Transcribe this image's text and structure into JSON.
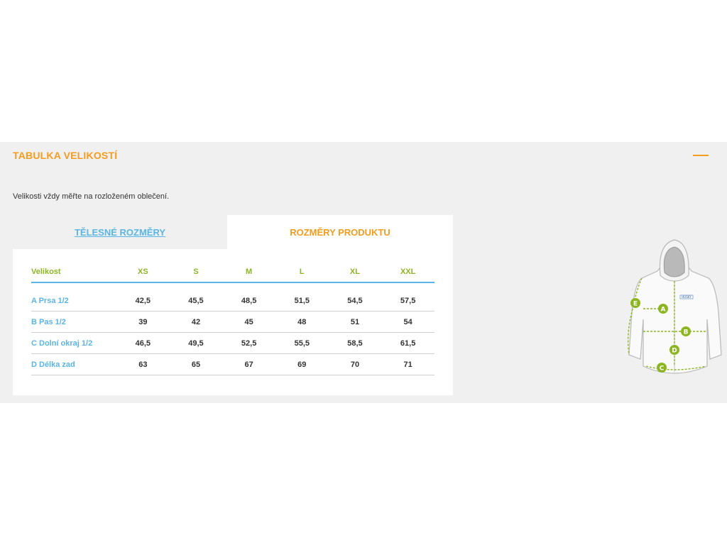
{
  "section": {
    "title": "TABULKA VELIKOSTÍ",
    "note": "Velikosti vždy měřte na rozloženém oblečení."
  },
  "tabs": [
    {
      "label": "TĚLESNÉ ROZMĚRY",
      "active": false
    },
    {
      "label": "ROZMĚRY PRODUKTU",
      "active": true
    }
  ],
  "table": {
    "headers": [
      "Velikost",
      "XS",
      "S",
      "M",
      "L",
      "XL",
      "XXL"
    ],
    "rows": [
      {
        "label": "A Prsa 1/2",
        "values": [
          "42,5",
          "45,5",
          "48,5",
          "51,5",
          "54,5",
          "57,5"
        ]
      },
      {
        "label": "B Pas 1/2",
        "values": [
          "39",
          "42",
          "45",
          "48",
          "51",
          "54"
        ]
      },
      {
        "label": "C Dolní okraj 1/2",
        "values": [
          "46,5",
          "49,5",
          "52,5",
          "55,5",
          "58,5",
          "61,5"
        ]
      },
      {
        "label": "D Délka zad",
        "values": [
          "63",
          "65",
          "67",
          "69",
          "70",
          "71"
        ]
      }
    ]
  },
  "diagram": {
    "markers": [
      "A",
      "B",
      "C",
      "D",
      "E"
    ],
    "logo_text": "HUSKY"
  },
  "colors": {
    "accent_orange": "#f39c1e",
    "accent_blue": "#5bb5e3",
    "accent_green": "#8cb521",
    "panel_bg": "#f0f0f0"
  }
}
